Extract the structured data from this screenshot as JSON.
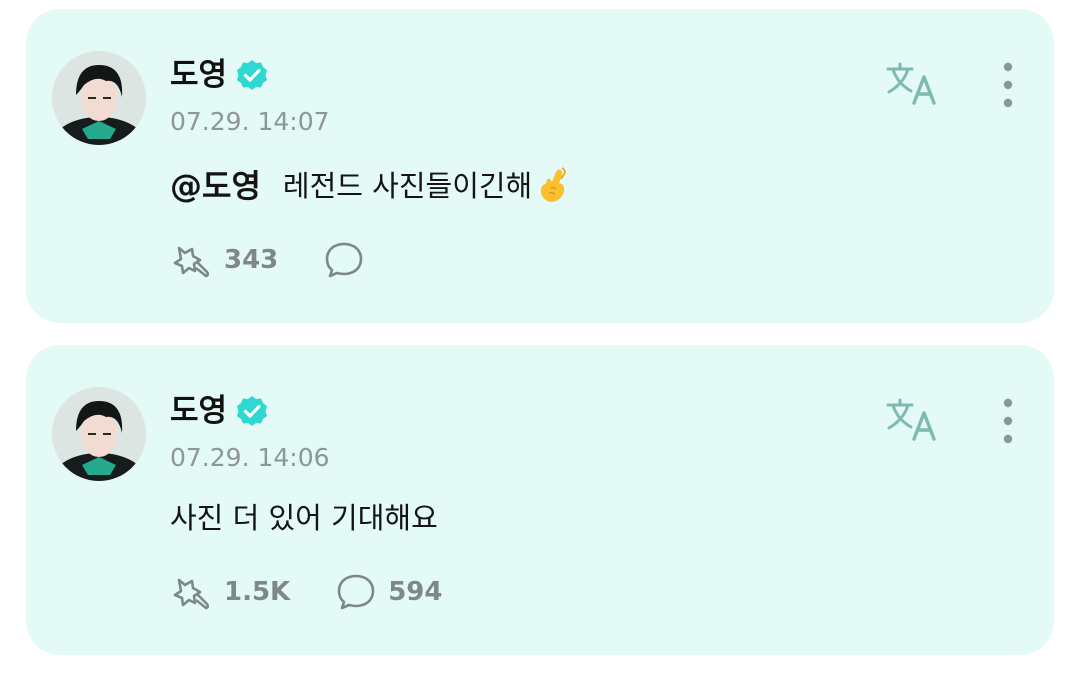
{
  "posts": [
    {
      "author": "도영",
      "timestamp": "07.29. 14:07",
      "mention": "@도영",
      "text": "레전드 사진들이긴해",
      "emoji": "crossed-fingers-heart-emoji",
      "likes": "343",
      "comments": ""
    },
    {
      "author": "도영",
      "timestamp": "07.29. 14:06",
      "mention": "",
      "text": "사진 더 있어 기대해요",
      "likes": "1.5K",
      "comments": "594"
    }
  ],
  "icons": {
    "verified": "verified-badge-icon",
    "translate": "translate-icon",
    "more": "more-vertical-icon",
    "like": "reaction-icon",
    "comment": "comment-bubble-icon"
  },
  "colors": {
    "card_background": "#e3faf6",
    "verified": "#2fd8d0",
    "muted": "#8d9796"
  }
}
